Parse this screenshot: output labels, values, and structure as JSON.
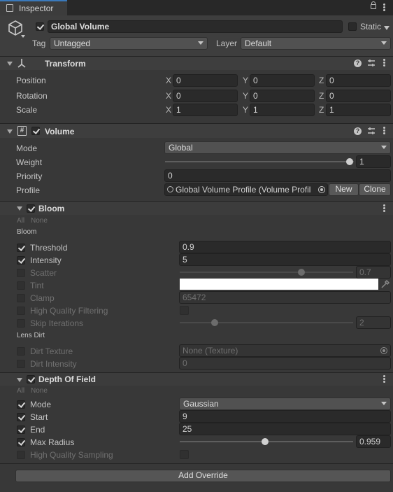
{
  "tab": {
    "label": "Inspector"
  },
  "object": {
    "name": "Global Volume",
    "static_label": "Static",
    "tag_label": "Tag",
    "tag_value": "Untagged",
    "layer_label": "Layer",
    "layer_value": "Default"
  },
  "transform": {
    "title": "Transform",
    "rows": [
      {
        "label": "Position",
        "x": "0",
        "y": "0",
        "z": "0"
      },
      {
        "label": "Rotation",
        "x": "0",
        "y": "0",
        "z": "0"
      },
      {
        "label": "Scale",
        "x": "1",
        "y": "1",
        "z": "1"
      }
    ],
    "axis": {
      "x": "X",
      "y": "Y",
      "z": "Z"
    }
  },
  "volume": {
    "title": "Volume",
    "mode_label": "Mode",
    "mode_value": "Global",
    "weight_label": "Weight",
    "weight_value": "1",
    "weight_fraction": 1.0,
    "priority_label": "Priority",
    "priority_value": "0",
    "profile_label": "Profile",
    "profile_value": "Global Volume Profile (Volume Profil",
    "new_label": "New",
    "clone_label": "Clone"
  },
  "bloom": {
    "title": "Bloom",
    "all": "All",
    "none": "None",
    "section1": "Bloom",
    "threshold_label": "Threshold",
    "threshold_value": "0.9",
    "intensity_label": "Intensity",
    "intensity_value": "5",
    "scatter_label": "Scatter",
    "scatter_value": "0.7",
    "scatter_fraction": 0.7,
    "tint_label": "Tint",
    "tint_color": "#ffffff",
    "clamp_label": "Clamp",
    "clamp_value": "65472",
    "hqf_label": "High Quality Filtering",
    "skip_label": "Skip Iterations",
    "skip_value": "2",
    "skip_fraction": 0.2,
    "section2": "Lens Dirt",
    "dirt_texture_label": "Dirt Texture",
    "dirt_texture_value": "None (Texture)",
    "dirt_intensity_label": "Dirt Intensity",
    "dirt_intensity_value": "0"
  },
  "dof": {
    "title": "Depth Of Field",
    "all": "All",
    "none": "None",
    "mode_label": "Mode",
    "mode_value": "Gaussian",
    "start_label": "Start",
    "start_value": "9",
    "end_label": "End",
    "end_value": "25",
    "maxradius_label": "Max Radius",
    "maxradius_value": "0.959",
    "maxradius_fraction": 0.49,
    "hqs_label": "High Quality Sampling"
  },
  "add_override": "Add Override"
}
